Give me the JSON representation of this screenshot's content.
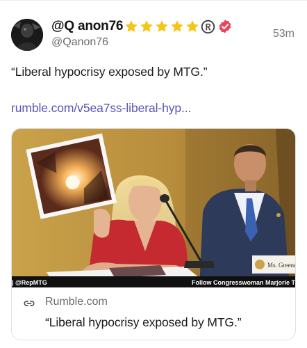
{
  "post": {
    "display_name": "@Q anon76",
    "handle": "@Qanon76",
    "timestamp": "53m",
    "badges": {
      "stars": 5,
      "star_color": "#f5c518",
      "registered_icon": "registered-icon",
      "verified_icon": "verified-icon",
      "verified_color": "#e9455a"
    },
    "text": "“Liberal hypocrisy exposed by MTG.”",
    "link_text": "rumble.com/v5ea7ss-liberal-hyp...",
    "link_color": "#5a55b8"
  },
  "card": {
    "image": {
      "caption_left": "| @RepMTG",
      "caption_right": "Follow Congresswoman Marjorie T",
      "nameplate": "Ms. Greene"
    },
    "domain": "Rumble.com",
    "title": "“Liberal hypocrisy exposed by MTG.”"
  }
}
